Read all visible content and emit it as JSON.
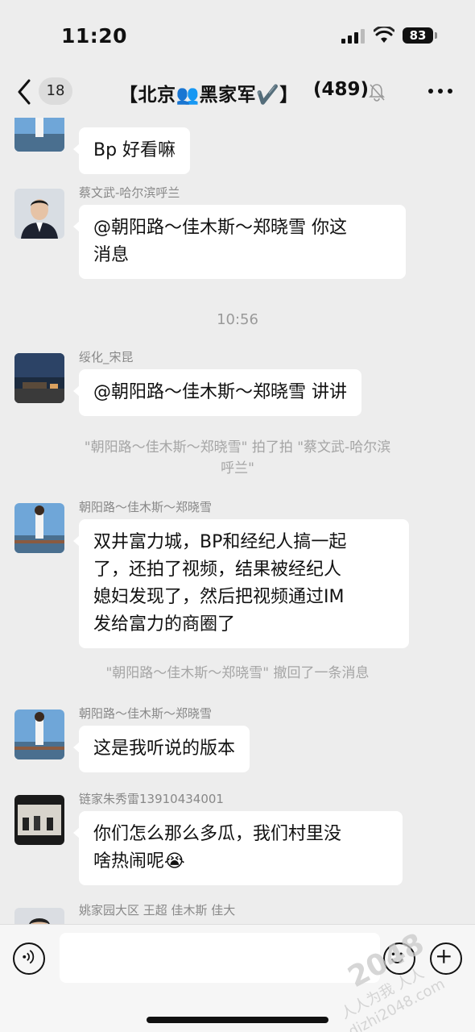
{
  "status_bar": {
    "time": "11:20",
    "battery": "83"
  },
  "nav": {
    "unread_count": "18",
    "title": "【北京👥黑家军✔️】",
    "member_count": "(489)"
  },
  "chat": {
    "messages": [
      {
        "text": "Bp 好看嘛"
      },
      {
        "sender": "蔡文武-哈尔滨呼兰",
        "text_line1": "@朝阳路～佳木斯～郑晓雪 你这",
        "text_line2": "消息"
      },
      {
        "time": "10:56"
      },
      {
        "sender": "绥化_宋昆",
        "text": "@朝阳路～佳木斯～郑晓雪 讲讲"
      },
      {
        "system_line1": "\"朝阳路～佳木斯～郑晓雪\" 拍了拍 \"蔡文武-哈尔滨",
        "system_line2": "呼兰\""
      },
      {
        "sender": "朝阳路～佳木斯～郑晓雪",
        "text_line1": "双井富力城，BP和经纪人搞一起",
        "text_line2": "了，还拍了视频，结果被经纪人",
        "text_line3": "媳妇发现了，然后把视频通过IM",
        "text_line4": "发给富力的商圈了"
      },
      {
        "system": "\"朝阳路～佳木斯～郑晓雪\" 撤回了一条消息"
      },
      {
        "sender": "朝阳路～佳木斯～郑晓雪",
        "text": "这是我听说的版本"
      },
      {
        "sender": "链家朱秀雷13910434001",
        "text_line1": "你们怎么那么多瓜，我们村里没",
        "text_line2": "啥热闹呢😭"
      },
      {
        "sender": "姚家园大区 王超 佳木斯 佳大"
      }
    ]
  },
  "icons": {
    "back": "chevron-left-icon",
    "mute": "bell-slash-icon",
    "more": "more-dots-icon",
    "voice": "voice-icon",
    "emoji": "emoji-icon",
    "plus": "plus-icon"
  },
  "watermark": {
    "line1": "2048",
    "line2": "人人为我 人人",
    "line3": "dizhi2048.com"
  }
}
